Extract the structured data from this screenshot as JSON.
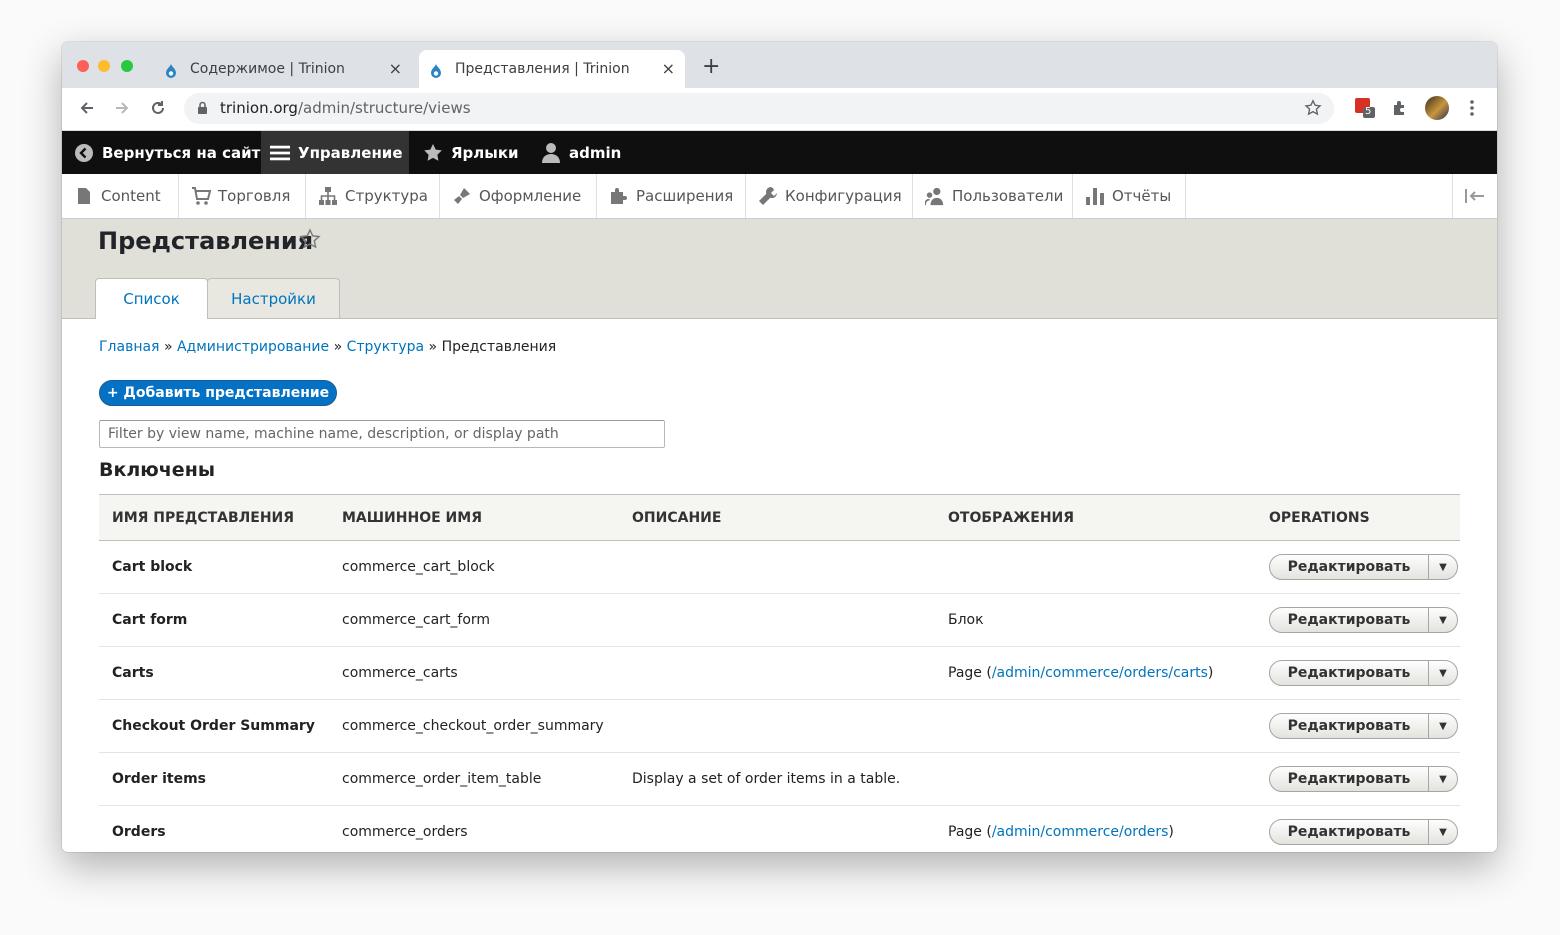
{
  "browser": {
    "tabs": [
      {
        "title": "Содержимое | Trinion",
        "close": "×"
      },
      {
        "title": "Представления | Trinion",
        "close": "×"
      }
    ],
    "new_tab": "+",
    "url_host": "trinion.org",
    "url_path": "/admin/structure/views",
    "ext_badge": "5"
  },
  "admin_toolbar": {
    "back": "Вернуться на сайт",
    "manage": "Управление",
    "shortcuts": "Ярлыки",
    "user": "admin"
  },
  "menu": {
    "items": [
      "Content",
      "Торговля",
      "Структура",
      "Оформление",
      "Расширения",
      "Конфигурация",
      "Пользователи",
      "Отчёты"
    ]
  },
  "page": {
    "title": "Представления",
    "tabs": [
      "Список",
      "Настройки"
    ],
    "breadcrumb": {
      "home": "Главная",
      "admin": "Администрирование",
      "structure": "Структура",
      "current": "Представления",
      "sep": "»"
    },
    "add_button": "+ Добавить представление",
    "filter_placeholder": "Filter by view name, machine name, description, or display path",
    "section_heading": "Включены"
  },
  "table": {
    "headers": [
      "Имя представления",
      "Машинное имя",
      "Описание",
      "Отображения",
      "Operations"
    ],
    "edit_label": "Редактировать",
    "rows": [
      {
        "name": "Cart block",
        "machine": "commerce_cart_block",
        "description": "",
        "display": "",
        "path": ""
      },
      {
        "name": "Cart form",
        "machine": "commerce_cart_form",
        "description": "",
        "display": "Блок",
        "path": ""
      },
      {
        "name": "Carts",
        "machine": "commerce_carts",
        "description": "",
        "display": "Page (",
        "path": "/admin/commerce/orders/carts"
      },
      {
        "name": "Checkout Order Summary",
        "machine": "commerce_checkout_order_summary",
        "description": "",
        "display": "",
        "path": ""
      },
      {
        "name": "Order items",
        "machine": "commerce_order_item_table",
        "description": "Display a set of order items in a table.",
        "display": "",
        "path": ""
      },
      {
        "name": "Orders",
        "machine": "commerce_orders",
        "description": "",
        "display": "Page (",
        "path": "/admin/commerce/orders"
      }
    ]
  },
  "colors": {
    "link": "#0074bd",
    "primary_button": "#0571c4",
    "admin_bar": "#0f0f0f"
  }
}
